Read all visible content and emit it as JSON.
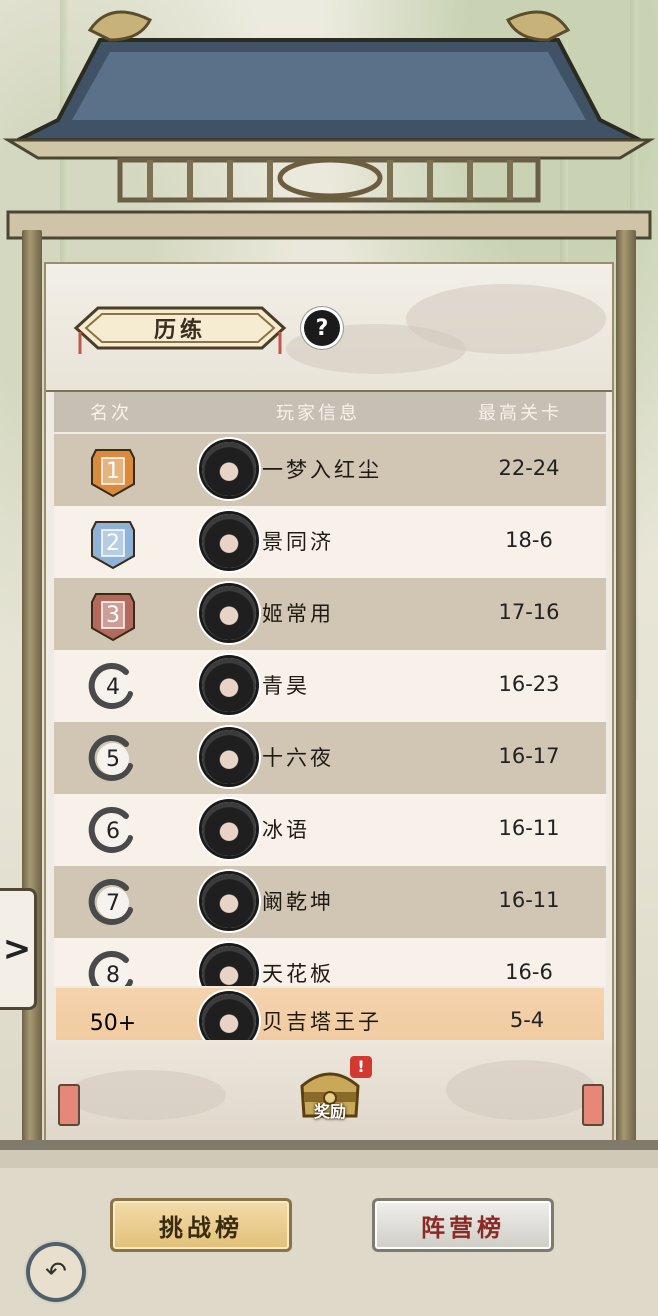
{
  "mode": {
    "label": "历练",
    "help": "?"
  },
  "columns": {
    "rank": "名次",
    "player": "玩家信息",
    "best": "最高关卡"
  },
  "rows": [
    {
      "rank": "1",
      "medal": "gold",
      "name": "一梦入红尘",
      "score": "22-24"
    },
    {
      "rank": "2",
      "medal": "blue",
      "name": "景同济",
      "score": "18-6"
    },
    {
      "rank": "3",
      "medal": "red",
      "name": "姬常用",
      "score": "17-16"
    },
    {
      "rank": "4",
      "medal": "none",
      "name": "青昊",
      "score": "16-23"
    },
    {
      "rank": "5",
      "medal": "none",
      "name": "十六夜",
      "score": "16-17"
    },
    {
      "rank": "6",
      "medal": "none",
      "name": "冰语",
      "score": "16-11"
    },
    {
      "rank": "7",
      "medal": "none",
      "name": "阚乾坤",
      "score": "16-11"
    },
    {
      "rank": "8",
      "medal": "none",
      "name": "天花板",
      "score": "16-6"
    }
  ],
  "me": {
    "rank": "50+",
    "name": "贝吉塔王子",
    "score": "5-4"
  },
  "reward": {
    "label": "奖励",
    "badge": "!"
  },
  "tabs": {
    "challenge": "挑战榜",
    "camp": "阵营榜"
  },
  "side_tab": ">",
  "back": "↶",
  "colors": {
    "row_dark": "#d1c5b3",
    "row_light": "#f7f1ea",
    "me_row": "#f0c89d",
    "gold": "#d98a3a",
    "blue": "#8fb3d6",
    "red": "#b36a5c"
  }
}
